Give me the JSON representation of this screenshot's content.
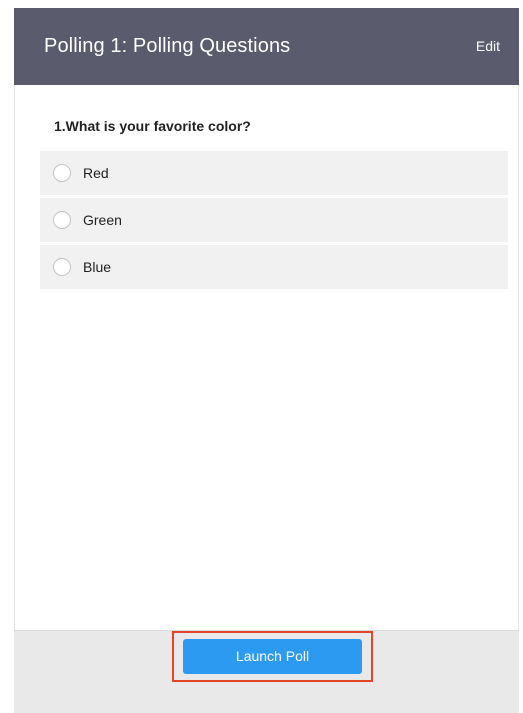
{
  "header": {
    "title": "Polling 1: Polling Questions",
    "edit_label": "Edit",
    "background_color": "#5a5b6c"
  },
  "question": {
    "text": "1.What is your favorite color?",
    "options": [
      {
        "label": "Red",
        "selected": false
      },
      {
        "label": "Green",
        "selected": false
      },
      {
        "label": "Blue",
        "selected": false
      }
    ]
  },
  "footer": {
    "launch_label": "Launch Poll",
    "button_color": "#2c9af1",
    "highlight_color": "#e3452b"
  }
}
